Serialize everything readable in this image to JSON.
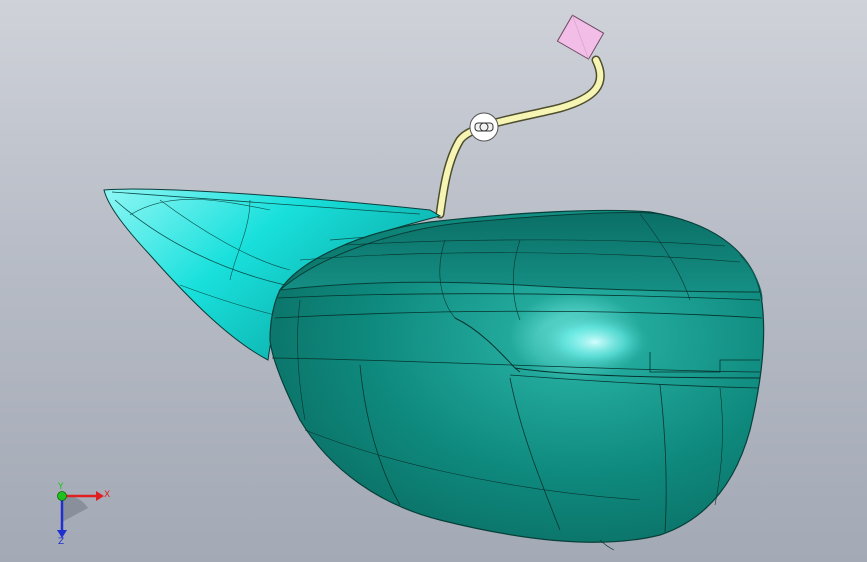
{
  "viewport": {
    "name": "3d-model-viewport",
    "background_top": "#cfd2d9",
    "background_bottom": "#a3a9b5"
  },
  "model": {
    "body_color": "#0f8a7e",
    "highlight_color": "#00e6e0",
    "cable_color": "#f7f5b4",
    "connector_color": "#f2bde6"
  },
  "triad": {
    "x_label": "X",
    "y_label": "Y",
    "z_label": "Z",
    "x_color": "#e02020",
    "y_color": "#20c020",
    "z_color": "#2030d0"
  }
}
